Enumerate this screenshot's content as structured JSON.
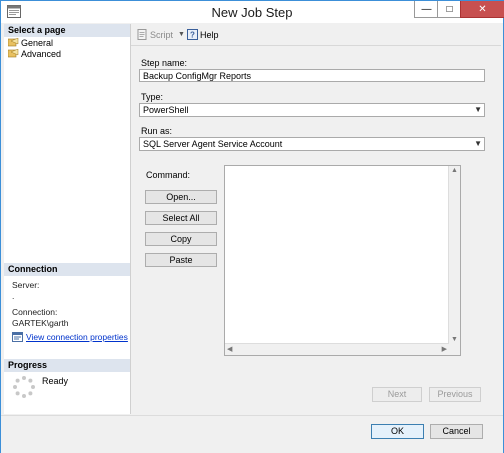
{
  "window": {
    "title": "New Job Step",
    "controls": {
      "minimize": "—",
      "maximize": "□",
      "close": "✕"
    }
  },
  "sidebar": {
    "select_page_header": "Select a page",
    "pages": [
      {
        "label": "General",
        "icon": "page-icon"
      },
      {
        "label": "Advanced",
        "icon": "page-icon"
      }
    ],
    "connection_header": "Connection",
    "server_label": "Server:",
    "server_value": ".",
    "connection_label": "Connection:",
    "connection_value": "GARTEK\\garth",
    "view_connection_link": "View connection properties",
    "progress_header": "Progress",
    "progress_status": "Ready"
  },
  "toolbar": {
    "script_label": "Script",
    "help_label": "Help"
  },
  "form": {
    "step_name_label": "Step name:",
    "step_name_value": "Backup ConfigMgr Reports",
    "type_label": "Type:",
    "type_value": "PowerShell",
    "run_as_label": "Run as:",
    "run_as_value": "SQL Server Agent Service Account",
    "command_label": "Command:",
    "command_value": "",
    "open_button": "Open...",
    "select_all_button": "Select All",
    "copy_button": "Copy",
    "paste_button": "Paste",
    "next_button": "Next",
    "previous_button": "Previous"
  },
  "footer": {
    "ok_button": "OK",
    "cancel_button": "Cancel"
  }
}
